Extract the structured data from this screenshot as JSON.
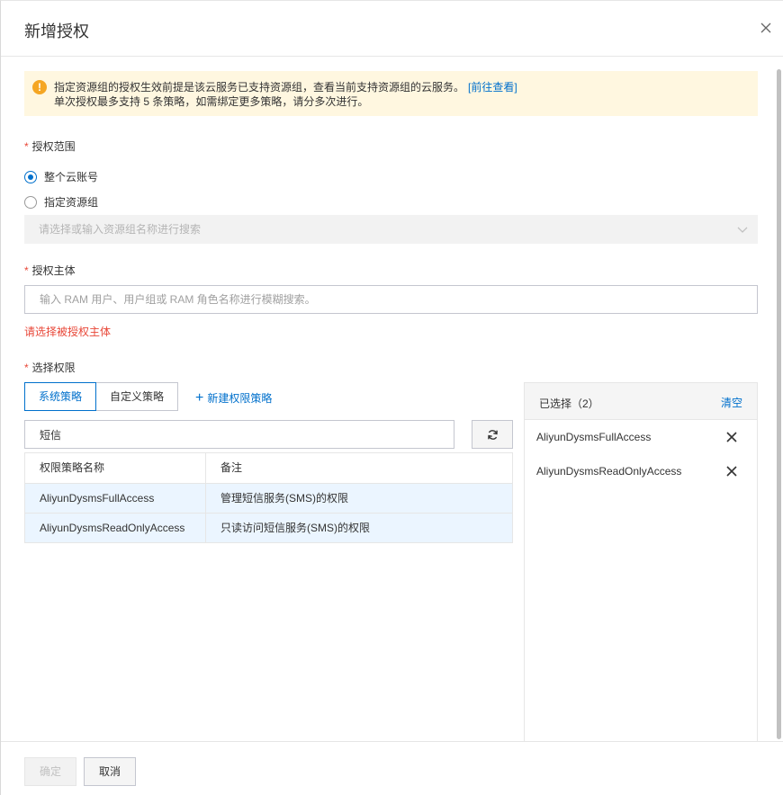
{
  "dialog": {
    "title": "新增授权",
    "close_icon": "close-icon"
  },
  "notice": {
    "line1": "指定资源组的授权生效前提是该云服务已支持资源组，查看当前支持资源组的云服务。",
    "link": "[前往查看]",
    "line2": "单次授权最多支持 5 条策略，如需绑定更多策略，请分多次进行。",
    "icon": "warning-icon",
    "color": "#fff7e0"
  },
  "scope": {
    "label": "授权范围",
    "option_all": "整个云账号",
    "option_group": "指定资源组",
    "selected": "整个云账号",
    "group_select_placeholder": "请选择或输入资源组名称进行搜索"
  },
  "principal": {
    "label": "授权主体",
    "placeholder": "输入 RAM 用户、用户组或 RAM 角色名称进行模糊搜索。",
    "value": "",
    "error": "请选择被授权主体"
  },
  "permissions": {
    "label": "选择权限",
    "tabs": [
      {
        "label": "系统策略",
        "active": true
      },
      {
        "label": "自定义策略",
        "active": false
      }
    ],
    "new_policy": "新建权限策略",
    "search_value": "短信",
    "table": {
      "headers": [
        "权限策略名称",
        "备注"
      ],
      "rows": [
        {
          "name": "AliyunDysmsFullAccess",
          "note": "管理短信服务(SMS)的权限"
        },
        {
          "name": "AliyunDysmsReadOnlyAccess",
          "note": "只读访问短信服务(SMS)的权限"
        }
      ]
    }
  },
  "selected": {
    "title": "已选择（2）",
    "clear": "清空",
    "items": [
      "AliyunDysmsFullAccess",
      "AliyunDysmsReadOnlyAccess"
    ]
  },
  "footer": {
    "confirm": "确定",
    "cancel": "取消"
  },
  "colors": {
    "accent": "#0070cc",
    "required": "#e84738",
    "selected_row": "#ebf5ff"
  }
}
